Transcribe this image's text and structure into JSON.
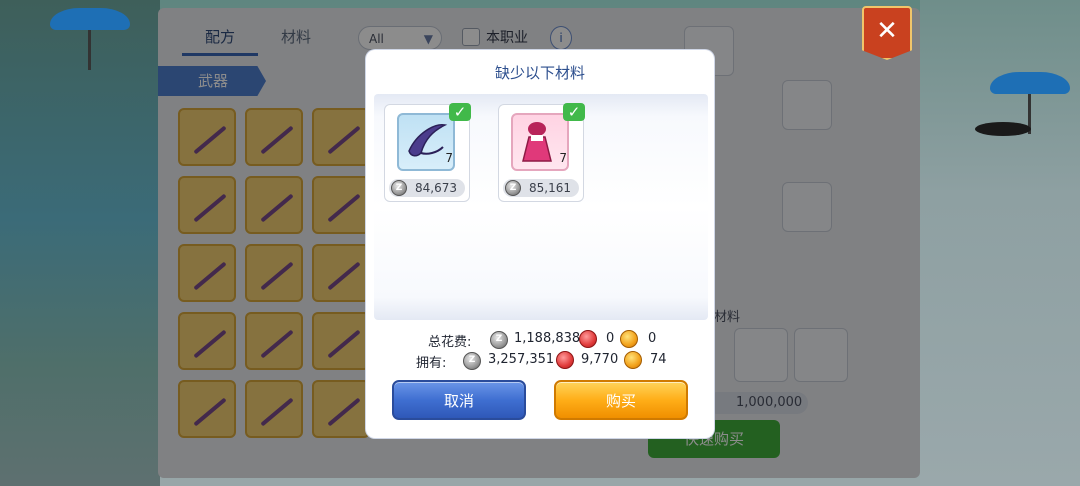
{
  "background_panel": {
    "tabs": [
      "配方",
      "材料"
    ],
    "filter_value": "All",
    "own_job_label": "本职业",
    "category_label": "武器",
    "coin_amount": "1,000,000",
    "craft_button_label": "快速购买",
    "panel_label": "材料"
  },
  "modal": {
    "title": "缺少以下材料",
    "materials": [
      {
        "icon": "purple-blade-icon",
        "qty": "7",
        "price": "84,673"
      },
      {
        "icon": "pink-dress-icon",
        "qty": "7",
        "price": "85,161"
      }
    ],
    "total_cost_label": "总花费:",
    "total_zeny": "1,188,838",
    "total_red": "0",
    "total_yellow": "0",
    "owned_label": "拥有:",
    "owned_zeny": "3,257,351",
    "owned_red": "9,770",
    "owned_yellow": "74",
    "cancel_label": "取消",
    "buy_label": "购买"
  },
  "colors": {
    "modal_title": "#2d4f8e",
    "cancel_button": "#3f6fd1",
    "buy_button": "#ffae18",
    "check_green": "#41b94a"
  }
}
